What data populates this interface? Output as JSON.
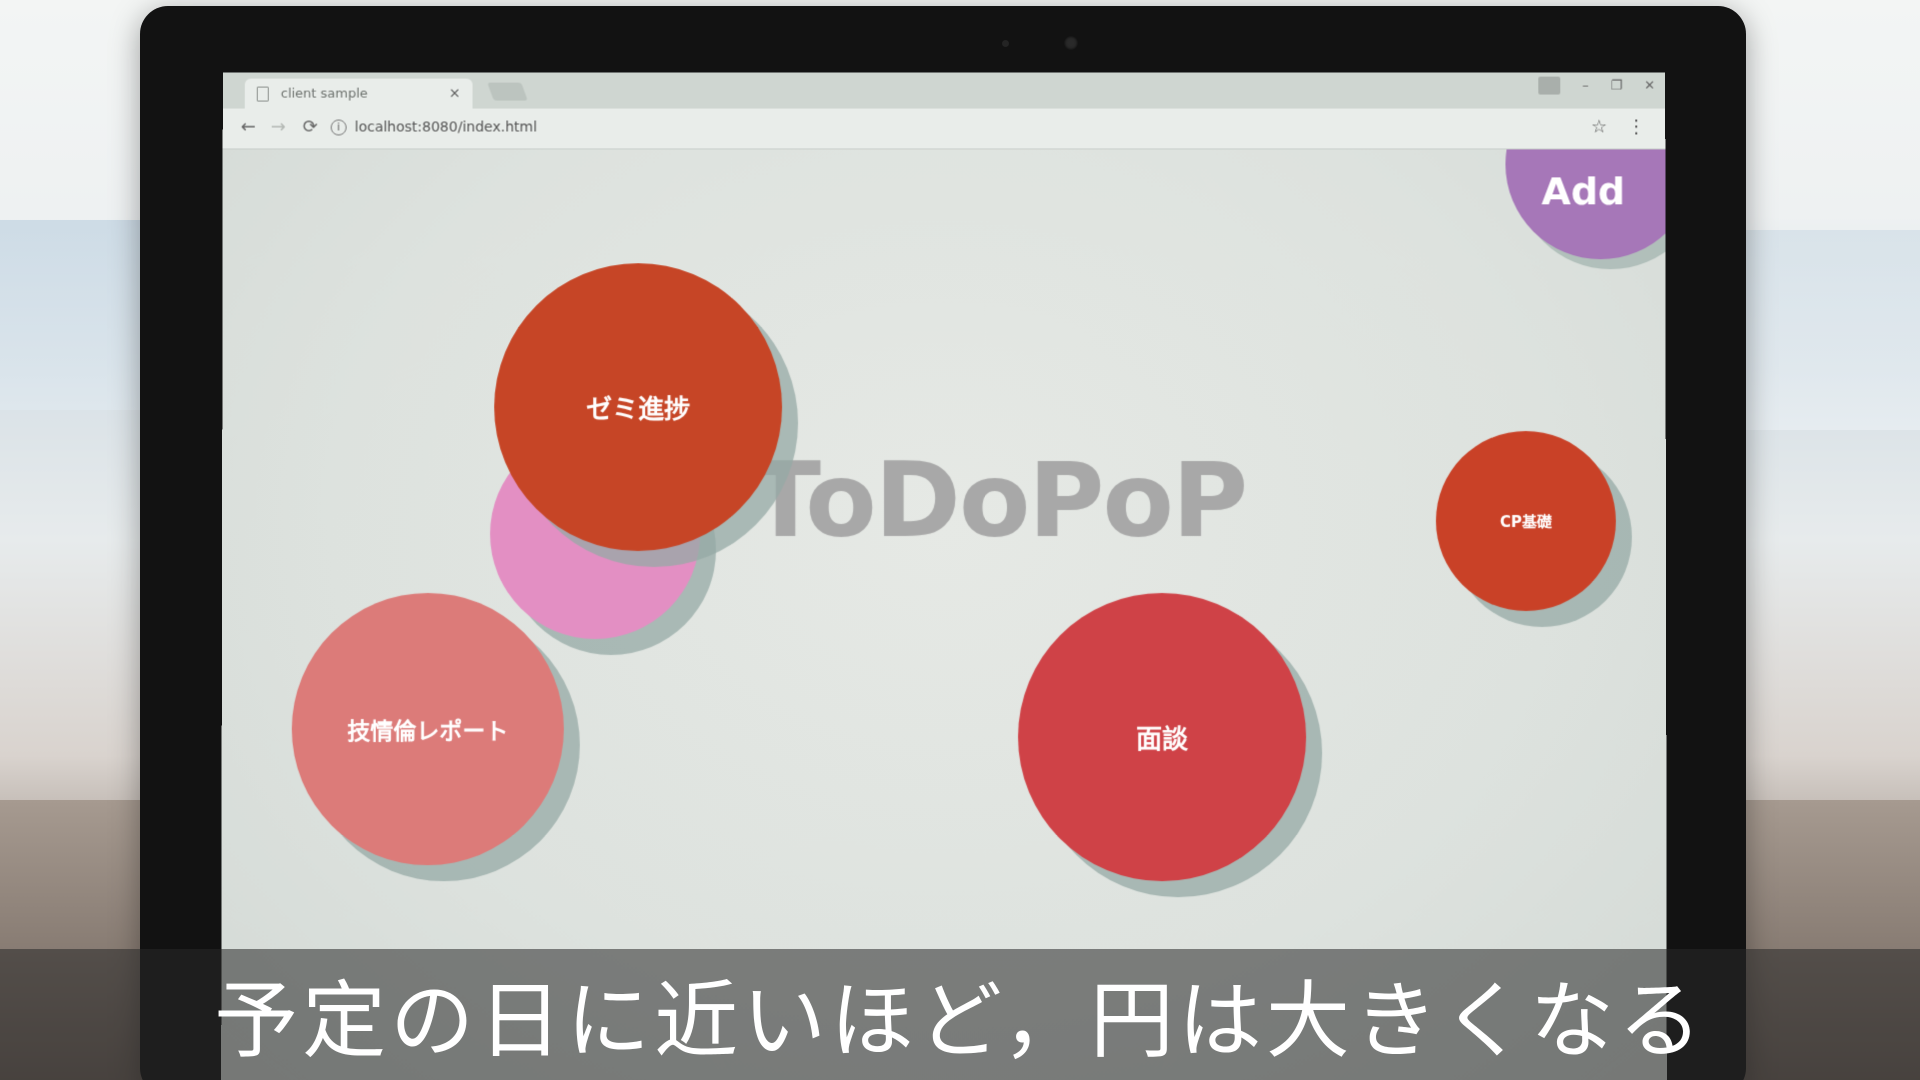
{
  "browser": {
    "tab_title": "client sample",
    "tab_close": "×",
    "url": "localhost:8080/index.html",
    "window_controls": {
      "minimize": "–",
      "restore": "❐",
      "close": "✕"
    },
    "nav": {
      "back": "←",
      "forward": "→",
      "reload": "⟳"
    },
    "icons": {
      "info": "i",
      "star": "☆",
      "menu": "⋮"
    }
  },
  "app": {
    "logo": "ToDoPoP",
    "add_label": "Add",
    "bubbles": [
      {
        "label": "ゼミ進捗",
        "color": "#c64526"
      },
      {
        "label": "",
        "color": "#e38fc3"
      },
      {
        "label": "技情倫レポート",
        "color": "#dc7b79"
      },
      {
        "label": "面談",
        "color": "#cf4247"
      },
      {
        "label": "CP基礎",
        "color": "#c94127"
      }
    ]
  },
  "subtitle": "予定の日に近いほど，円は大きくなる"
}
